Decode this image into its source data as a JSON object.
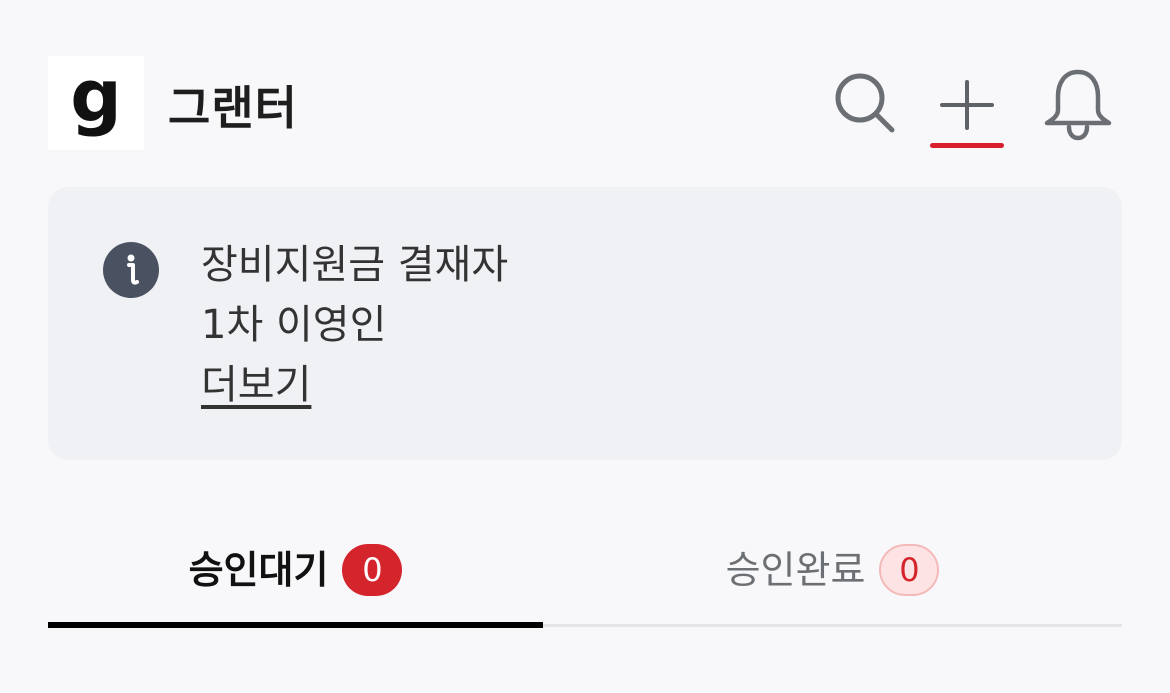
{
  "header": {
    "logo_glyph": "g",
    "app_name": "그랜터",
    "icons": [
      "search-icon",
      "plus-icon",
      "bell-icon"
    ],
    "accent_color": "#d81f2b"
  },
  "info": {
    "icon": "info-icon",
    "line1": "장비지원금 결재자",
    "line2": "1차 이영인",
    "more_label": "더보기"
  },
  "tabs": [
    {
      "label": "승인대기",
      "count": "0",
      "active": true
    },
    {
      "label": "승인완료",
      "count": "0",
      "active": false
    }
  ]
}
